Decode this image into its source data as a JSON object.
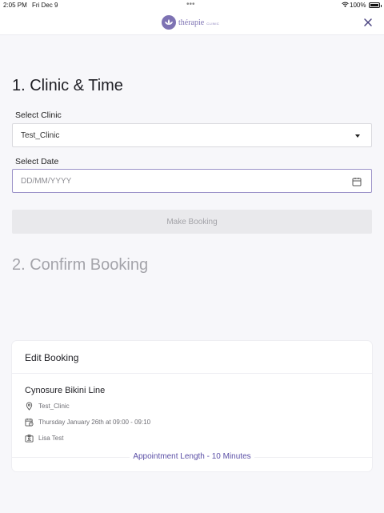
{
  "status_bar": {
    "time": "2:05 PM",
    "date": "Fri Dec 9",
    "dots": "•••",
    "battery_pct": "100%"
  },
  "header": {
    "logo_name": "thérapie",
    "logo_sub": "CLINIC",
    "brand_color": "#7d72b3"
  },
  "section1": {
    "title": "1. Clinic & Time",
    "clinic_label": "Select Clinic",
    "clinic_value": "Test_Clinic",
    "date_label": "Select Date",
    "date_placeholder": "DD/MM/YYYY",
    "make_booking_label": "Make Booking"
  },
  "section2": {
    "title": "2. Confirm Booking"
  },
  "edit_booking": {
    "title": "Edit Booking",
    "treatment": "Cynosure Bikini Line",
    "clinic": "Test_Clinic",
    "datetime": "Thursday January 26th at 09:00 - 09:10",
    "staff": "Lisa Test",
    "appointment_length": "Appointment Length - 10 Minutes",
    "icons": [
      "location-pin-icon",
      "calendar-clock-icon",
      "badge-icon"
    ]
  }
}
